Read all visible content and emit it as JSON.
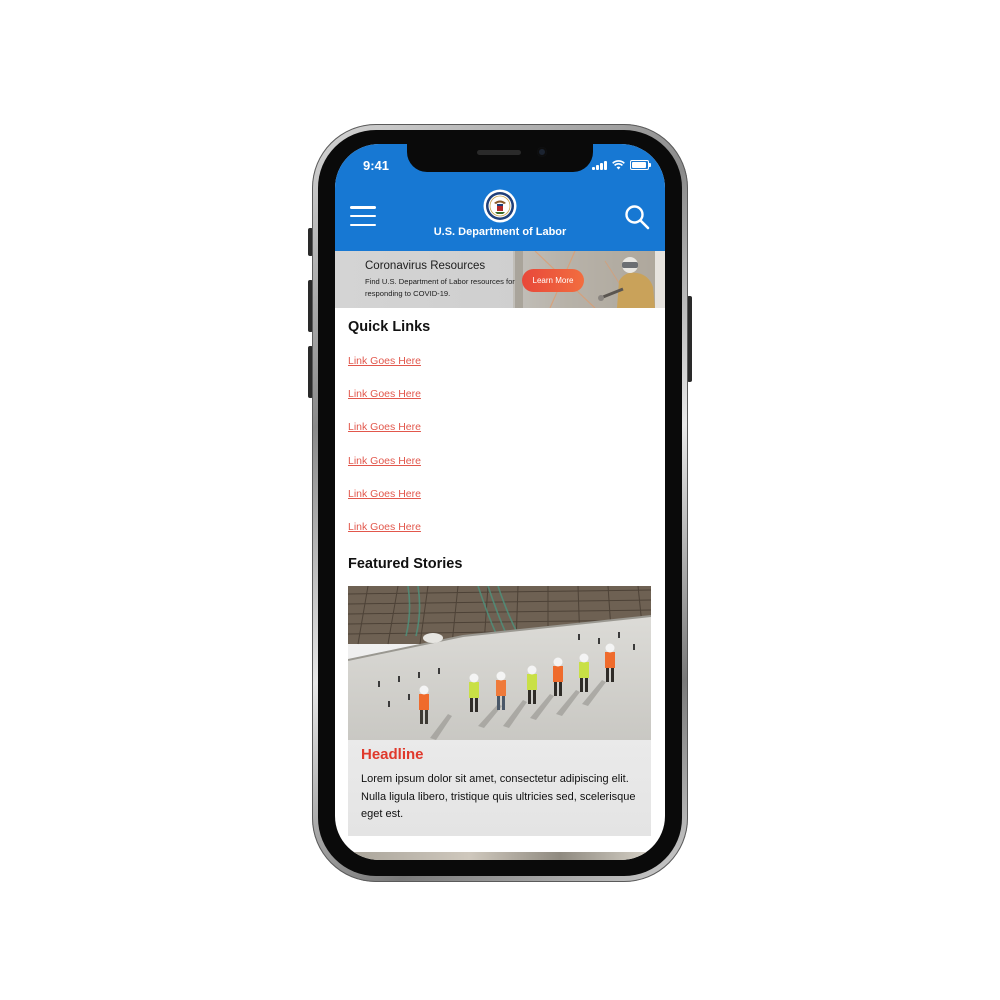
{
  "status_bar": {
    "time": "9:41"
  },
  "header": {
    "agency_name": "U.S. Department of Labor",
    "background_color": "#1778d3",
    "menu_icon": "hamburger-menu-icon",
    "search_icon": "search-icon",
    "logo": "dol-seal-logo"
  },
  "banner": {
    "title": "Coronavirus Resources",
    "text": "Find U.S. Department of Labor resources for responding to COVID-19.",
    "button_label": "Learn More",
    "button_color": "#ec553c"
  },
  "quick_links": {
    "title": "Quick Links",
    "link_color": "#e2574c",
    "items": [
      {
        "label": "Link Goes Here"
      },
      {
        "label": "Link Goes Here"
      },
      {
        "label": "Link Goes Here"
      },
      {
        "label": "Link Goes Here"
      },
      {
        "label": "Link Goes Here"
      },
      {
        "label": "Link Goes Here"
      }
    ]
  },
  "featured": {
    "title": "Featured Stories",
    "stories": [
      {
        "headline": "Headline",
        "headline_color": "#e0392c",
        "body": "Lorem ipsum dolor sit amet, consectetur adipiscing elit. Nulla ligula libero, tristique quis ultricies sed, scelerisque eget est."
      }
    ]
  }
}
